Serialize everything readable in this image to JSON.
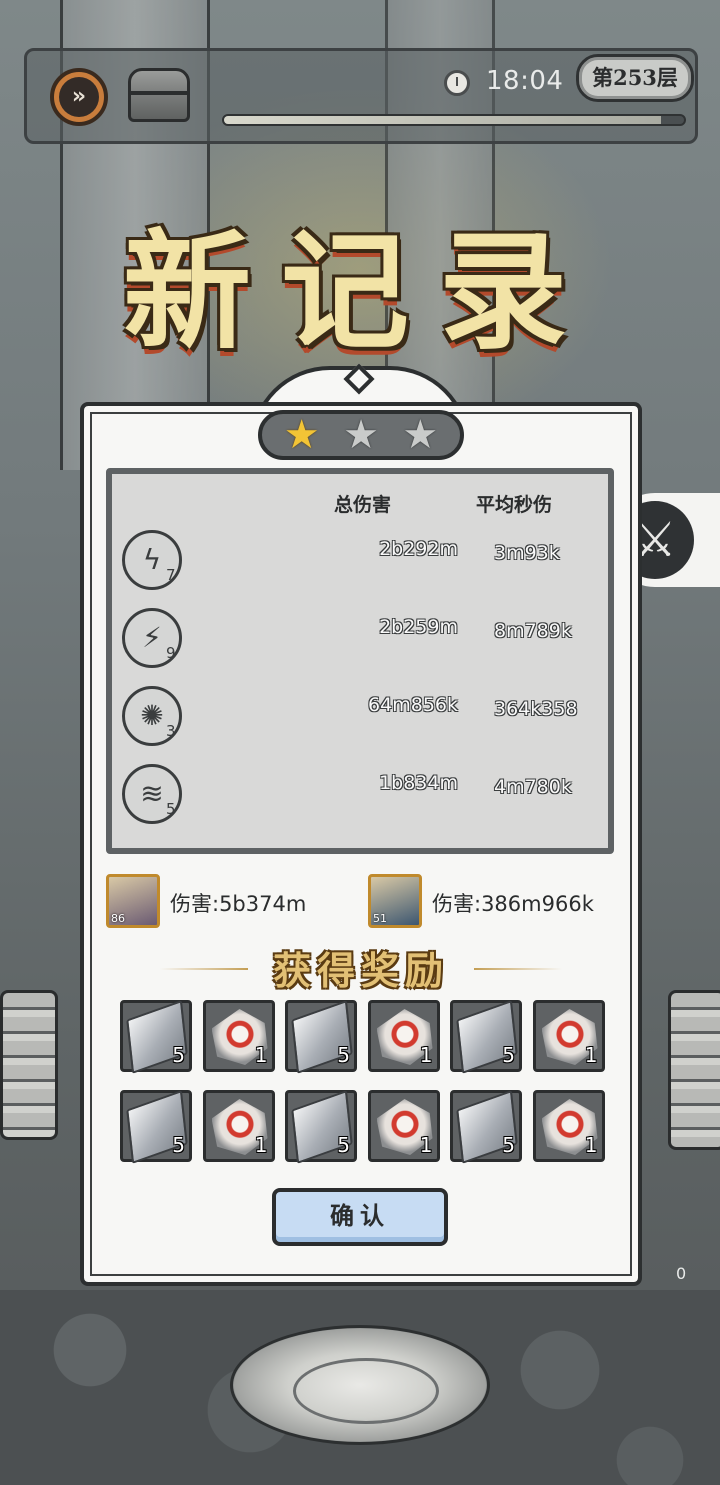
{
  "hud": {
    "speed_icon": "fast-forward",
    "chest_icon": "treasure-chest",
    "clock_icon": "clock",
    "timer": "18:04",
    "floor": "第253层",
    "progress_fraction": 0.95
  },
  "title": "新记录",
  "side_button_icon": "crossed-swords",
  "result": {
    "stars_earned": 1,
    "stars_total": 3,
    "headers": {
      "total_damage": "总伤害",
      "avg_dps": "平均秒伤"
    },
    "skills": [
      {
        "icon": "lightning-swirl",
        "level": "7",
        "total": "2b292m",
        "dps": "3m93k"
      },
      {
        "icon": "chain-lightning",
        "level": "9",
        "total": "2b259m",
        "dps": "8m789k"
      },
      {
        "icon": "burst-barrier",
        "level": "3",
        "total": "64m856k",
        "dps": "364k358"
      },
      {
        "icon": "whirlwind",
        "level": "5",
        "total": "1b834m",
        "dps": "4m780k"
      }
    ],
    "heroes": [
      {
        "level": "86",
        "damage": "伤害:5b374m",
        "portrait_color": "#6a5a72"
      },
      {
        "level": "51",
        "damage": "伤害:386m966k",
        "portrait_color": "#3c5670"
      }
    ]
  },
  "rewards": {
    "title": "获得奖励",
    "items": [
      {
        "type": "stone",
        "qty": "5"
      },
      {
        "type": "crystal",
        "qty": "1"
      },
      {
        "type": "stone",
        "qty": "5"
      },
      {
        "type": "crystal",
        "qty": "1"
      },
      {
        "type": "stone",
        "qty": "5"
      },
      {
        "type": "crystal",
        "qty": "1"
      },
      {
        "type": "stone",
        "qty": "5"
      },
      {
        "type": "crystal",
        "qty": "1"
      },
      {
        "type": "stone",
        "qty": "5"
      },
      {
        "type": "crystal",
        "qty": "1"
      },
      {
        "type": "stone",
        "qty": "5"
      },
      {
        "type": "crystal",
        "qty": "1"
      }
    ]
  },
  "confirm_label": "确认",
  "corner_counter": "0"
}
